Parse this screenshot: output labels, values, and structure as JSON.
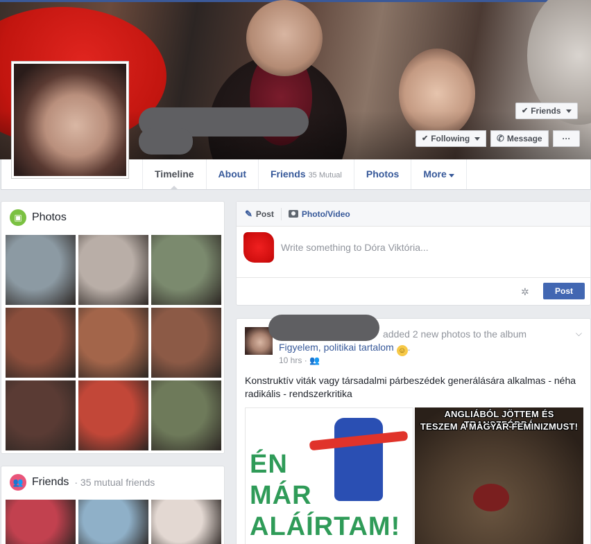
{
  "cover_buttons": {
    "friends": "Friends",
    "following": "Following",
    "message": "Message",
    "more": "···"
  },
  "nav": {
    "tabs": [
      {
        "label": "Timeline"
      },
      {
        "label": "About"
      },
      {
        "label": "Friends",
        "sub": "35 Mutual"
      },
      {
        "label": "Photos"
      },
      {
        "label": "More"
      }
    ]
  },
  "photos": {
    "title": "Photos",
    "tiles": [
      "#8c9aa3",
      "#b9aea7",
      "#7b8a6e",
      "#8a4e3c",
      "#a3654a",
      "#8c5a46",
      "#5a3b34",
      "#c24738",
      "#6e7a5a"
    ]
  },
  "friends_card": {
    "title": "Friends",
    "sub": "· 35 mutual friends",
    "tiles": [
      "#c2414f",
      "#8fb0c8",
      "#e3d8d2"
    ]
  },
  "composer": {
    "tab_post": "Post",
    "tab_photo": "Photo/Video",
    "placeholder": "Write something to Dóra Viktória...",
    "post_button": "Post"
  },
  "feed_post": {
    "action": "added 2 new photos to the album",
    "album": "Figyelem, politikai tartalom",
    "emoji": "☺",
    "period": ".",
    "time": "10 hrs",
    "text": "Konstruktív viták vagy társadalmi párbeszédek generálására alkalmas - néha radikális - rendszerkritika",
    "image1_lines": [
      "ÉN",
      "MÁR",
      "ALÁÍRTAM!"
    ],
    "image2_caption": [
      "ANGLIÁBÓL JÖTTEM ÉS TRANSZFÓBBÁ",
      "TESZEM A MAGYAR FEMINIZMUST!"
    ]
  }
}
